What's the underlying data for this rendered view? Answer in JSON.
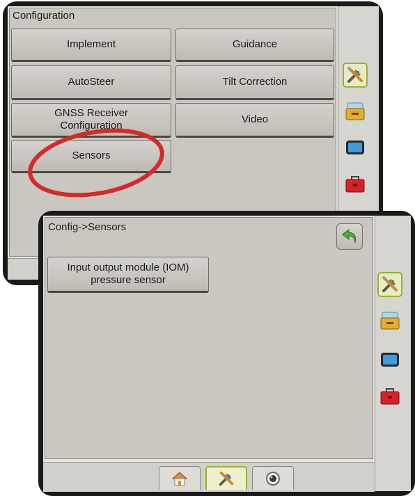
{
  "back_screen": {
    "title": "Configuration",
    "buttons": {
      "implement": "Implement",
      "guidance": "Guidance",
      "autosteer": "AutoSteer",
      "tilt": "Tilt Correction",
      "gnss_line1": "GNSS Receiver",
      "gnss_line2": "Configuration",
      "video": "Video",
      "sensors": "Sensors"
    }
  },
  "front_screen": {
    "title": "Config->Sensors",
    "iom_line1": "Input output module (IOM)",
    "iom_line2": "pressure sensor"
  },
  "side_tabs": [
    "tools-icon",
    "console-icon",
    "display-icon",
    "toolbox-icon"
  ],
  "bottom_nav": [
    "home-icon",
    "tools-icon",
    "camera-icon"
  ],
  "colors": {
    "highlight_circle": "#d42a2a",
    "selected_tab_border": "#9bb03c",
    "back_arrow": "#4caf2a"
  }
}
